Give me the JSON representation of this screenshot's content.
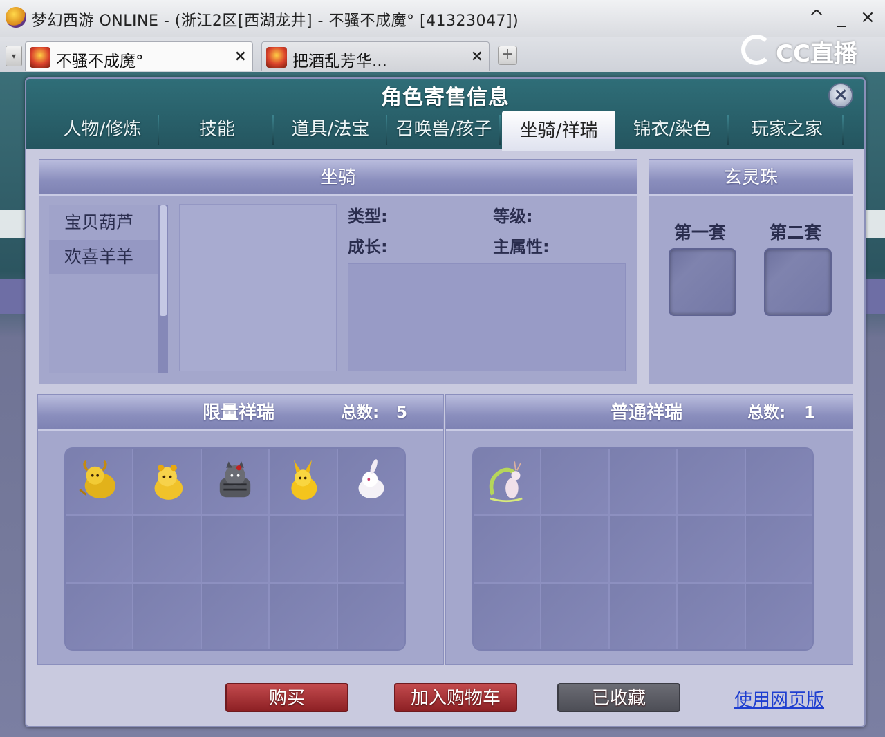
{
  "window": {
    "title": "梦幻西游 ONLINE - (浙江2区[西湖龙井] - 不骚不成魔° [41323047])",
    "controls": {
      "up": "^",
      "minimize": "_",
      "close": "×"
    }
  },
  "browser_tabs": [
    {
      "label": "不骚不成魔°",
      "close": "×"
    },
    {
      "label": "把酒乱芳华...",
      "close": "×"
    }
  ],
  "tab_add": "+",
  "tab_scroll": "▾",
  "brand": {
    "text": "CC直播"
  },
  "dialog": {
    "title": "角色寄售信息",
    "close": "×",
    "tabs": [
      {
        "label": "人物/修炼",
        "active": false
      },
      {
        "label": "技能",
        "active": false
      },
      {
        "label": "道具/法宝",
        "active": false
      },
      {
        "label": "召唤兽/孩子",
        "active": false
      },
      {
        "label": "坐骑/祥瑞",
        "active": true
      },
      {
        "label": "锦衣/染色",
        "active": false
      },
      {
        "label": "玩家之家",
        "active": false
      }
    ]
  },
  "mount": {
    "header": "坐骑",
    "list": [
      "宝贝葫芦",
      "欢喜羊羊"
    ],
    "selected_index": 1,
    "attributes": {
      "type_label": "类型:",
      "level_label": "等级:",
      "growth_label": "成长:",
      "main_attr_label": "主属性:"
    }
  },
  "orb": {
    "header": "玄灵珠",
    "sets": [
      "第一套",
      "第二套"
    ]
  },
  "limited": {
    "header": "限量祥瑞",
    "count_label": "总数:",
    "count": "5",
    "pets": [
      {
        "name": "golden-bull-icon",
        "color": "#e2b21a"
      },
      {
        "name": "golden-tiger-icon",
        "color": "#f0c22a"
      },
      {
        "name": "gray-cat-icon",
        "color": "#55575e"
      },
      {
        "name": "golden-fox-icon",
        "color": "#f4c41c"
      },
      {
        "name": "white-rabbit-icon",
        "color": "#f4f1f6"
      }
    ]
  },
  "normal": {
    "header": "普通祥瑞",
    "count_label": "总数:",
    "count": "1",
    "pets": [
      {
        "name": "deer-spirit-icon",
        "color": "#b6d65a"
      }
    ]
  },
  "footer": {
    "buy": "购买",
    "add_cart": "加入购物车",
    "favorited": "已收藏",
    "web_version": "使用网页版"
  },
  "colors": {
    "dialog_head": "#2f6e78",
    "panel": "#a4a7cc",
    "buy_button": "#a8353a",
    "fav_button": "#5b5c64",
    "link": "#1f3fd0"
  }
}
